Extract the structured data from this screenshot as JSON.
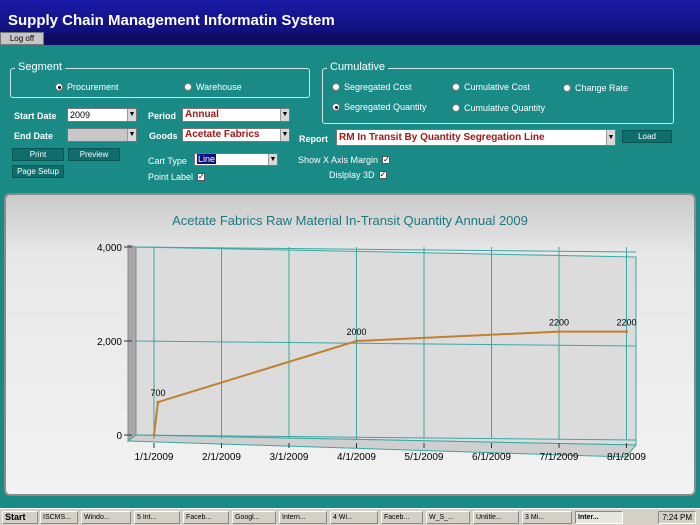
{
  "app": {
    "title": "Supply Chain Management Informatin System",
    "logoff": "Log off"
  },
  "segment": {
    "legend": "Segment",
    "options": [
      {
        "label": "Procurement",
        "selected": true
      },
      {
        "label": "Warehouse",
        "selected": false
      }
    ]
  },
  "cumulative": {
    "legend": "Cumulative",
    "options": [
      {
        "label": "Segregated Cost",
        "selected": false
      },
      {
        "label": "Cumulative Cost",
        "selected": false
      },
      {
        "label": "Change Rate",
        "selected": false
      },
      {
        "label": "Segregated Quantity",
        "selected": true
      },
      {
        "label": "Cumulative Quantity",
        "selected": false
      }
    ]
  },
  "form": {
    "start_date_label": "Start Date",
    "start_date_value": "2009",
    "end_date_label": "End Date",
    "end_date_value": "",
    "period_label": "Period",
    "period_value": "Annual",
    "goods_label": "Goods",
    "goods_value": "Acetate Fabrics",
    "report_label": "Report",
    "report_value": "RM In Transit By Quantity Segregation Line",
    "load_label": "Load",
    "print_label": "Print",
    "preview_label": "Preview",
    "page_setup_label": "Page Setup",
    "chart_type_label": "Cart Type",
    "chart_type_value": "Line",
    "point_label": "Point Label",
    "show_x_axis_margin": "Show X Axis Margin",
    "display_3d": "Dislplay 3D"
  },
  "chart_data": {
    "type": "line",
    "title": "Acetate Fabrics Raw Material In-Transit Quantity Annual 2009",
    "x": [
      "1/1/2009",
      "2/1/2009",
      "3/1/2009",
      "4/1/2009",
      "5/1/2009",
      "6/1/2009",
      "7/1/2009",
      "8/1/2009"
    ],
    "points": [
      {
        "x": "1/1/2009",
        "y": 0,
        "label": ""
      },
      {
        "x": "1/1/2009",
        "y": 700,
        "label": "700"
      },
      {
        "x": "4/1/2009",
        "y": 2000,
        "label": "2000"
      },
      {
        "x": "7/1/2009",
        "y": 2200,
        "label": "2200"
      },
      {
        "x": "8/1/2009",
        "y": 2200,
        "label": "2200"
      }
    ],
    "y_ticks": [
      "0",
      "2,000",
      "4,000"
    ],
    "ylim": [
      0,
      4000
    ],
    "grid": true,
    "line_color": "#c08030",
    "title_color": "#1a7a80"
  },
  "taskbar": {
    "start": "Start",
    "items": [
      "ISCMS...",
      "Windo...",
      "5 Int...",
      "Faceb...",
      "Googl...",
      "Intern...",
      "4 Wi...",
      "Faceb...",
      "W_S_...",
      "Untitle...",
      "3 Mi...",
      "Inter..."
    ],
    "clock": "7:24 PM"
  }
}
